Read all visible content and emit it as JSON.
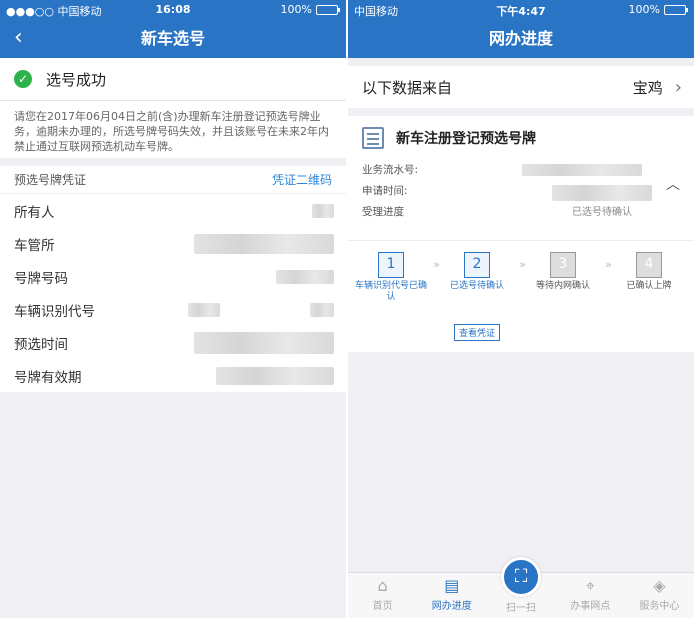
{
  "left": {
    "status": {
      "carrier": "●●●○○ 中国移动",
      "time": "16:08",
      "battery": "100%"
    },
    "nav": {
      "title": "新车选号"
    },
    "success_text": "选号成功",
    "notice": "请您在2017年06月04日之前(含)办理新车注册登记预选号牌业务，逾期未办理的，所选号牌号码失效，并且该账号在未来2年内禁止通过互联网预选机动车号牌。",
    "cert": {
      "label": "预选号牌凭证",
      "link": "凭证二维码"
    },
    "fields": [
      {
        "label": "所有人"
      },
      {
        "label": "车管所"
      },
      {
        "label": "号牌号码"
      },
      {
        "label": "车辆识别代号"
      },
      {
        "label": "预选时间"
      },
      {
        "label": "号牌有效期"
      }
    ]
  },
  "right": {
    "status": {
      "carrier": "中国移动",
      "time": "下午4:47",
      "battery": "100%"
    },
    "nav": {
      "title": "网办进度"
    },
    "source": {
      "label": "以下数据来自",
      "value": "宝鸡"
    },
    "card": {
      "title": "新车注册登记预选号牌",
      "serial_label": "业务流水号:",
      "time_label": "申请时间:",
      "progress_label": "受理进度",
      "progress_value": "已选号待确认",
      "steps": [
        {
          "num": "1",
          "label": "车辆识别代号已确认",
          "active": true
        },
        {
          "num": "2",
          "label": "已选号待确认",
          "active": true
        },
        {
          "num": "3",
          "label": "等待内网确认",
          "active": false
        },
        {
          "num": "4",
          "label": "已确认上牌",
          "active": false
        }
      ],
      "voucher_button": "查看凭证"
    },
    "tabs": [
      {
        "label": "首页",
        "icon": "home-icon"
      },
      {
        "label": "网办进度",
        "icon": "progress-icon"
      },
      {
        "label": "扫一扫",
        "icon": "scan-icon"
      },
      {
        "label": "办事网点",
        "icon": "location-icon"
      },
      {
        "label": "服务中心",
        "icon": "service-icon"
      }
    ]
  }
}
